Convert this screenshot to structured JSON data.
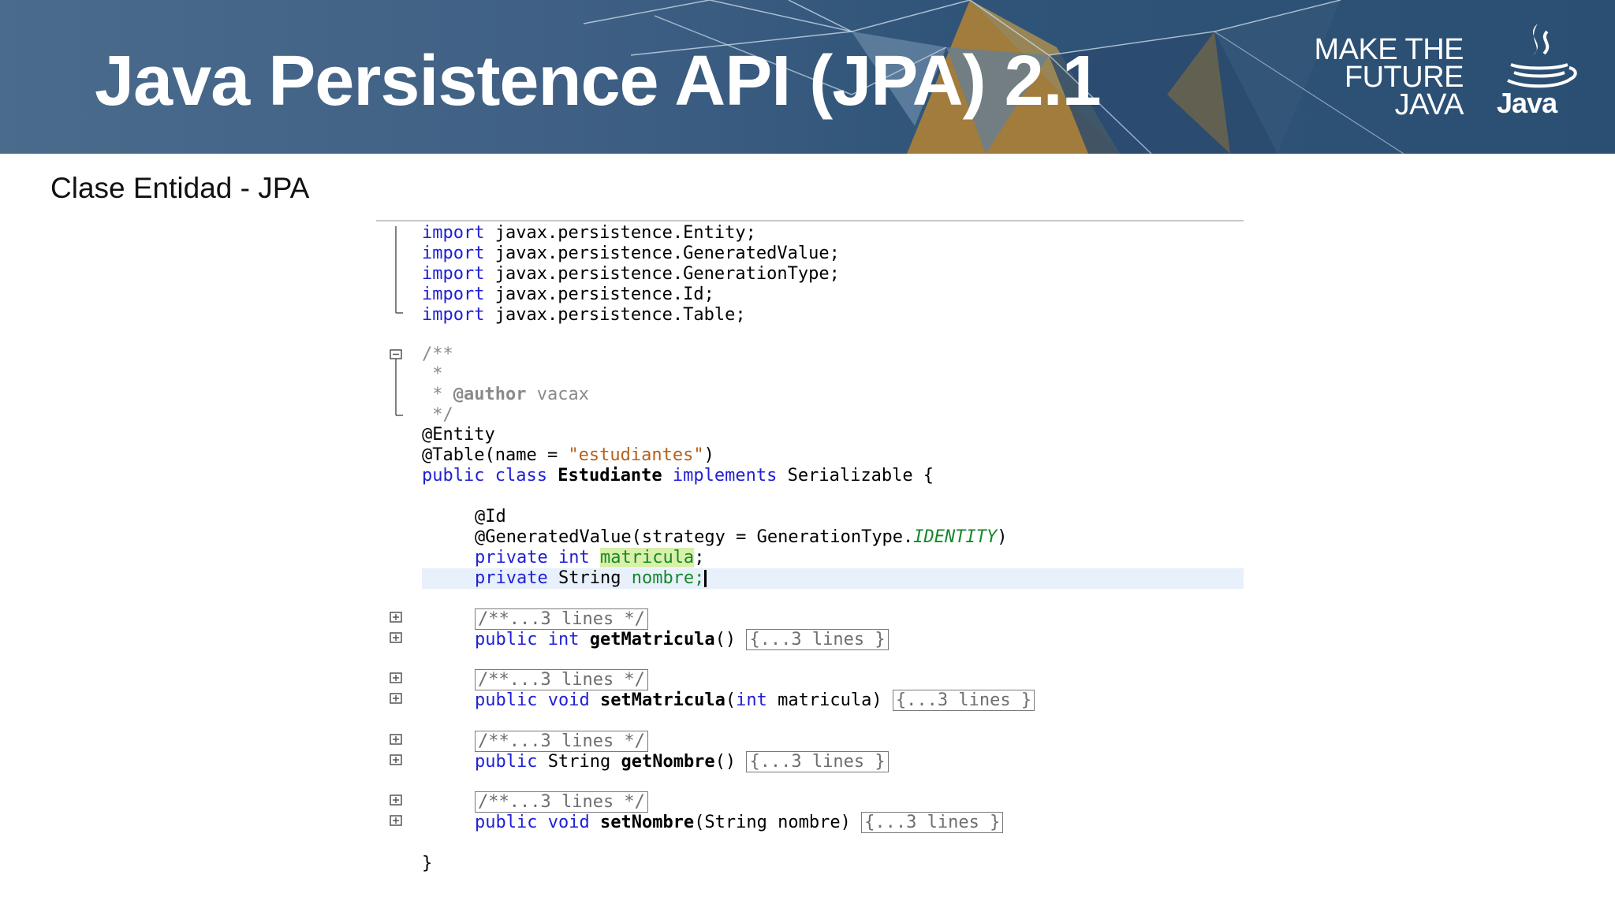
{
  "slide": {
    "title": "Java Persistence API (JPA) 2.1",
    "subtitle": "Clase Entidad - JPA"
  },
  "branding": {
    "tagline_1": "MAKE THE",
    "tagline_2": "FUTURE",
    "tagline_3": "JAVA",
    "logo_text": "Java",
    "logo_icon": "java-coffee-cup-icon",
    "colors": {
      "banner": "#3f6084",
      "accent_orange": "#d99a2b",
      "keyword": "#1f1fd6",
      "field": "#16882b",
      "string": "#b8601a",
      "comment": "#8a8a8a"
    }
  },
  "code": {
    "imports": [
      {
        "kw": "import",
        "rest": " javax.persistence.Entity;"
      },
      {
        "kw": "import",
        "rest": " javax.persistence.GeneratedValue;"
      },
      {
        "kw": "import",
        "rest": " javax.persistence.GenerationType;"
      },
      {
        "kw": "import",
        "rest": " javax.persistence.Id;"
      },
      {
        "kw": "import",
        "rest": " javax.persistence.Table;"
      }
    ],
    "javadoc_open": "/**",
    "javadoc_star": " *",
    "javadoc_author_prefix": " * ",
    "javadoc_author_tag": "@author",
    "javadoc_author_name": " vacax",
    "javadoc_close": " */",
    "annotation_entity": "@Entity",
    "table_annotation_start": "@Table(name = ",
    "table_name": "\"estudiantes\"",
    "table_annotation_end": ")",
    "kw_public": "public",
    "kw_class": "class",
    "class_name": "Estudiante",
    "kw_implements": "implements",
    "interface_and_brace": "Serializable {",
    "annotation_id": "@Id",
    "generated_value_start": "@GeneratedValue(strategy = GenerationType.",
    "generation_constant": "IDENTITY",
    "generated_value_end": ")",
    "kw_private": "private",
    "kw_int": "int",
    "field_matricula": "matricula",
    "semicolon": ";",
    "type_string": "String",
    "field_nombre": "nombre;",
    "folded_comment": "/**...3 lines */",
    "folded_body": "{...3 lines }",
    "kw_void": "void",
    "getter1_name": "getMatricula",
    "empty_params": "()",
    "setter1_name": "setMatricula",
    "setter1_open": "(",
    "setter1_param": " matricula)",
    "getter2_name": "getNombre",
    "setter2_name": "setNombre",
    "setter2_params": "(String nombre)",
    "closing_brace": "}"
  }
}
